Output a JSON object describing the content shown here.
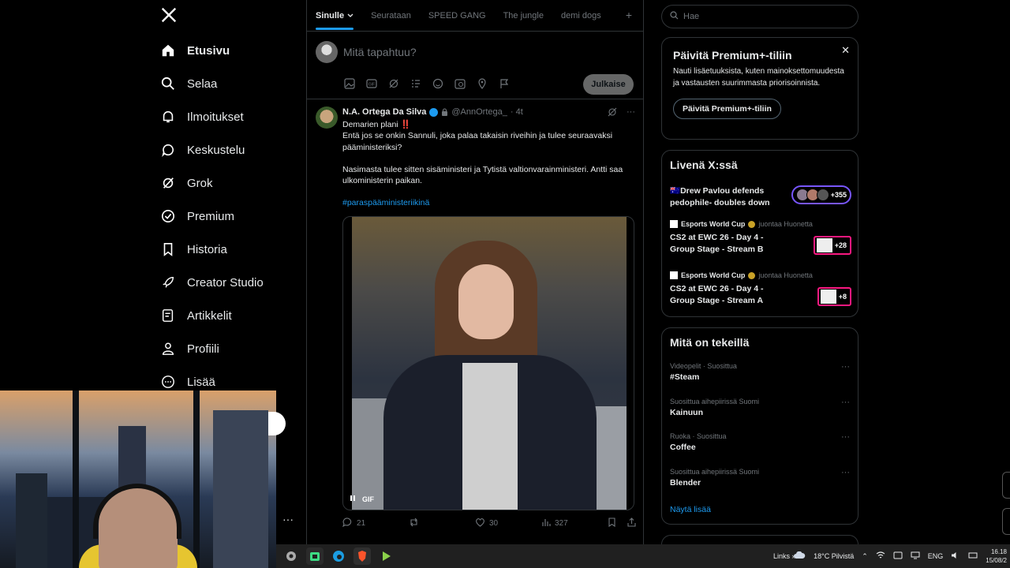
{
  "nav": {
    "items": [
      {
        "label": "Etusivu",
        "icon": "home-icon"
      },
      {
        "label": "Selaa",
        "icon": "search-icon"
      },
      {
        "label": "Ilmoitukset",
        "icon": "bell-icon"
      },
      {
        "label": "Keskustelu",
        "icon": "chat-icon"
      },
      {
        "label": "Grok",
        "icon": "grok-icon"
      },
      {
        "label": "Premium",
        "icon": "verified-icon"
      },
      {
        "label": "Historia",
        "icon": "bookmark-icon"
      },
      {
        "label": "Creator Studio",
        "icon": "rocket-icon"
      },
      {
        "label": "Artikkelit",
        "icon": "article-icon"
      },
      {
        "label": "Profiili",
        "icon": "person-icon"
      },
      {
        "label": "Lisää",
        "icon": "more-circle-icon"
      }
    ]
  },
  "tabs": [
    "Sinulle",
    "Seurataan",
    "SPEED GANG",
    "The jungle",
    "demi dogs"
  ],
  "composer": {
    "placeholder": "Mitä tapahtuu?",
    "post_label": "Julkaise"
  },
  "post": {
    "name": "N.A. Ortega Da Silva",
    "handle": "@AnnOrtega_",
    "time": "· 4t",
    "line1": "Demarien plani",
    "line1_emoji": "‼️",
    "line2": "Entä jos se onkin Sannuli, joka palaa takaisin riveihin ja tulee seuraavaksi pääministeriksi?",
    "line3": "Nasimasta tulee sitten sisäministeri ja Tytistä valtionvarainministeri. Antti saa ulkoministerin paikan.",
    "hashtag": "#paraspääministeriikinä",
    "media_badge": "GIF",
    "replies": "21",
    "likes": "30",
    "views": "327"
  },
  "search": {
    "placeholder": "Hae"
  },
  "premium": {
    "title": "Päivitä Premium+-tiliin",
    "desc": "Nauti lisäetuuksista, kuten mainoksettomuudesta ja vastausten suurimmasta priorisoinnista.",
    "button": "Päivitä Premium+-tiliin"
  },
  "live": {
    "title": "Livenä X:ssä",
    "items": [
      {
        "title": "Drew Pavlou defends pedophile- doubles down",
        "badge": "+355",
        "flag": "🇦🇺"
      },
      {
        "source": "Esports World Cup",
        "source_suffix": "juontaa Huonetta",
        "title": "CS2 at EWC 26 - Day 4 - Group Stage - Stream B",
        "badge": "+28"
      },
      {
        "source": "Esports World Cup",
        "source_suffix": "juontaa Huonetta",
        "title": "CS2 at EWC 26 - Day 4 - Group Stage - Stream A",
        "badge": "+8"
      }
    ]
  },
  "trends": {
    "title": "Mitä on tekeillä",
    "items": [
      {
        "meta": "Videopelit · Suosittua",
        "term": "#Steam"
      },
      {
        "meta": "Suosittua aihepiirissä Suomi",
        "term": "Kainuun"
      },
      {
        "meta": "Ruoka · Suosittua",
        "term": "Coffee"
      },
      {
        "meta": "Suosittua aihepiirissä Suomi",
        "term": "Blender"
      }
    ],
    "show_more": "Näytä lisää"
  },
  "taskbar": {
    "links": "Links",
    "weather": "18°C  Pilvistä",
    "lang": "ENG",
    "time": "16.18",
    "date": "15/08/2"
  },
  "colors": {
    "accent": "#1d9bf0",
    "background": "#000000",
    "border": "#2f3336",
    "muted": "#71767b"
  }
}
